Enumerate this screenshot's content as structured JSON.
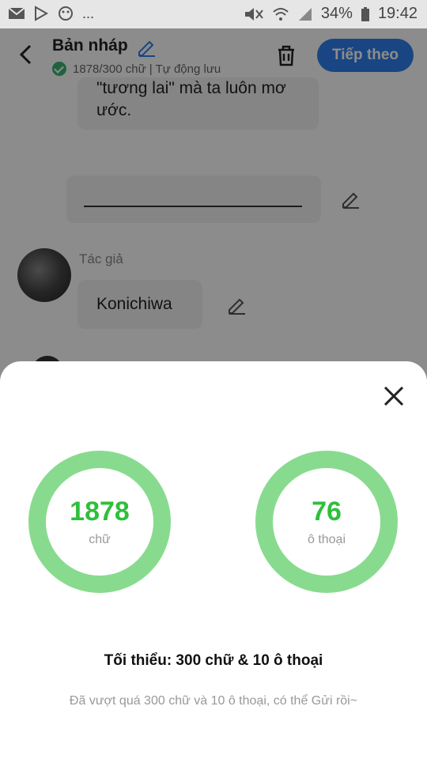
{
  "status_bar": {
    "notification_icons": [
      "mail-icon",
      "play-store-icon",
      "app-icon"
    ],
    "more": "...",
    "battery": "34%",
    "time": "19:42"
  },
  "header": {
    "title": "Bản nháp",
    "subtitle": "1878/300 chữ | Tự động lưu",
    "next_label": "Tiếp theo",
    "accent_color": "#2f80ed"
  },
  "content": {
    "bubble_text": "\"tương lai\" mà ta luôn mơ ước.",
    "author_label": "Tác giả",
    "author_name": "Konichiwa"
  },
  "sheet": {
    "stats": [
      {
        "value": "1878",
        "unit": "chữ"
      },
      {
        "value": "76",
        "unit": "ô thoại"
      }
    ],
    "minimum": "Tối thiểu: 300 chữ & 10 ô thoại",
    "note": "Đã vượt quá 300 chữ và 10 ô thoại, có thể Gửi rồi~",
    "ring_color": "#88db8e",
    "value_color": "#2fbf3b"
  }
}
